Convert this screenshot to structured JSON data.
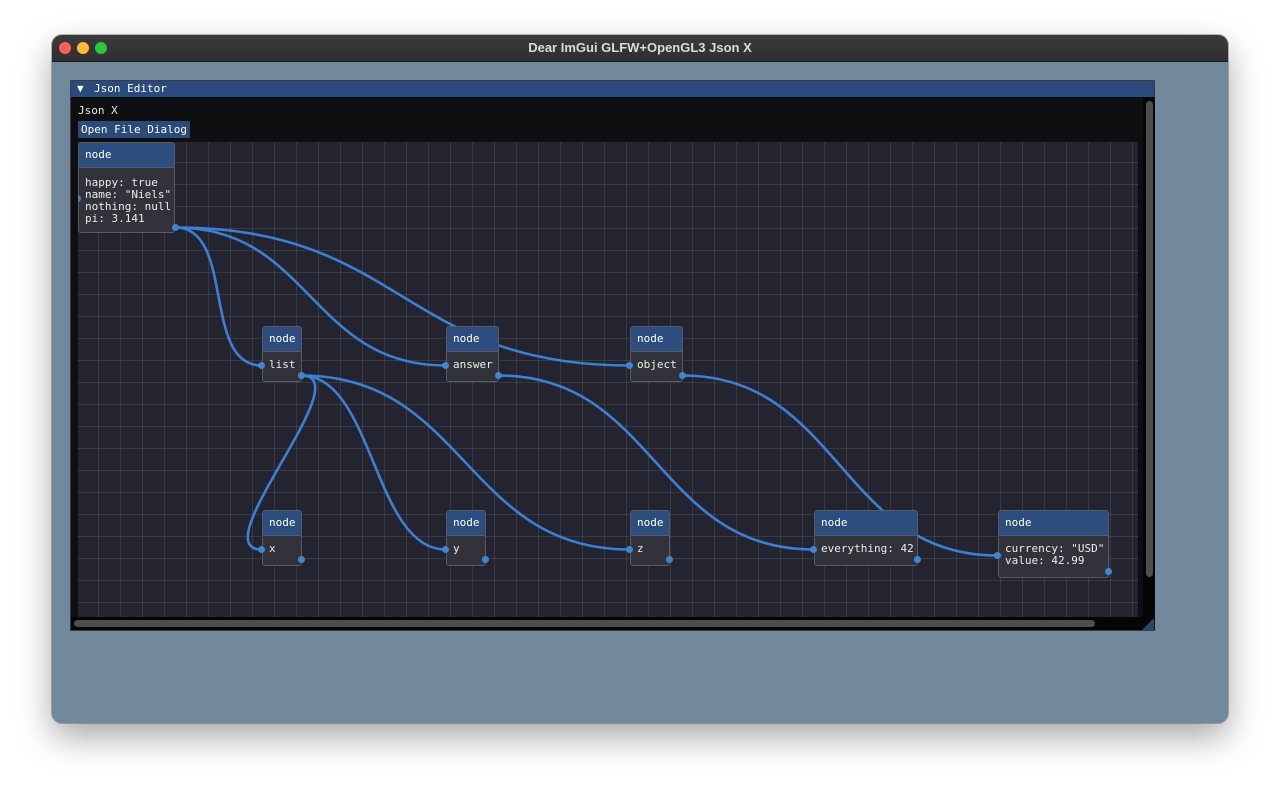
{
  "window": {
    "title": "Dear ImGui GLFW+OpenGL3 Json X"
  },
  "editor": {
    "title": "Json Editor",
    "collapse_icon": "collapse-arrow",
    "app_label": "Json X",
    "open_button": "Open File Dialog"
  },
  "nodes": {
    "root": {
      "header": "node",
      "fields": [
        "happy: true",
        "name: \"Niels\"",
        "nothing: null",
        "pi: 3.141"
      ]
    },
    "list": {
      "header": "node",
      "fields": [
        "list"
      ]
    },
    "answer": {
      "header": "node",
      "fields": [
        "answer"
      ]
    },
    "object": {
      "header": "node",
      "fields": [
        "object"
      ]
    },
    "x": {
      "header": "node",
      "fields": [
        "x"
      ]
    },
    "y": {
      "header": "node",
      "fields": [
        "y"
      ]
    },
    "z": {
      "header": "node",
      "fields": [
        "z"
      ]
    },
    "everything": {
      "header": "node",
      "fields": [
        "everything: 42"
      ]
    },
    "currency": {
      "header": "node",
      "fields": [
        "currency: \"USD\"",
        "value: 42.99"
      ]
    }
  },
  "links": [
    [
      "root",
      "list"
    ],
    [
      "root",
      "answer"
    ],
    [
      "root",
      "object"
    ],
    [
      "list",
      "x"
    ],
    [
      "list",
      "y"
    ],
    [
      "list",
      "z"
    ],
    [
      "answer",
      "everything"
    ],
    [
      "object",
      "currency"
    ]
  ],
  "colors": {
    "link": "#3d7fd4",
    "node_header": "#2d4d7e",
    "titlebar": "#294a7a",
    "desktop": "#71899a"
  }
}
